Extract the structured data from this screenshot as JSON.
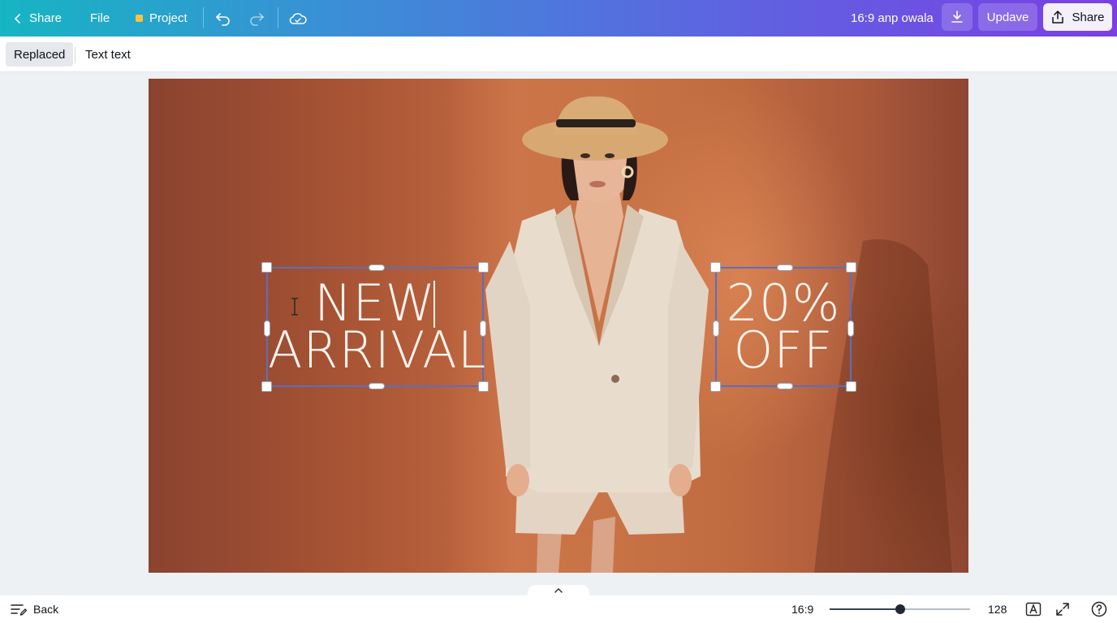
{
  "topbar": {
    "back_label": "Share",
    "file_label": "File",
    "project_label": "Project",
    "doc_title": "16:9 anp owala",
    "update_label": "Updave",
    "share_label": "Share"
  },
  "subbar": {
    "replaced_label": "Replaced",
    "text_label": "Text text"
  },
  "canvas": {
    "headline_line1": "NEW",
    "headline_line2": "ARRIVAL",
    "offer_line1": "20%",
    "offer_line2": "OFF"
  },
  "bottombar": {
    "back_label": "Back",
    "aspect_label": "16:9",
    "zoom_value": "128",
    "zoom_fraction": 0.5
  },
  "icons": {
    "back": "chevron-left-icon",
    "undo": "undo-icon",
    "redo": "redo-icon",
    "cloud": "cloud-icon",
    "download": "download-icon",
    "share": "share-icon",
    "notes": "notes-icon",
    "collapse": "chevron-up-icon",
    "text-overlay": "text-overlay-icon",
    "fullscreen": "fullscreen-icon",
    "help": "help-icon"
  },
  "colors": {
    "topbar_start": "#16b5c3",
    "topbar_end": "#7b3fe4",
    "selection": "#5a6fbf",
    "canvas_bg": "#b9613c"
  }
}
